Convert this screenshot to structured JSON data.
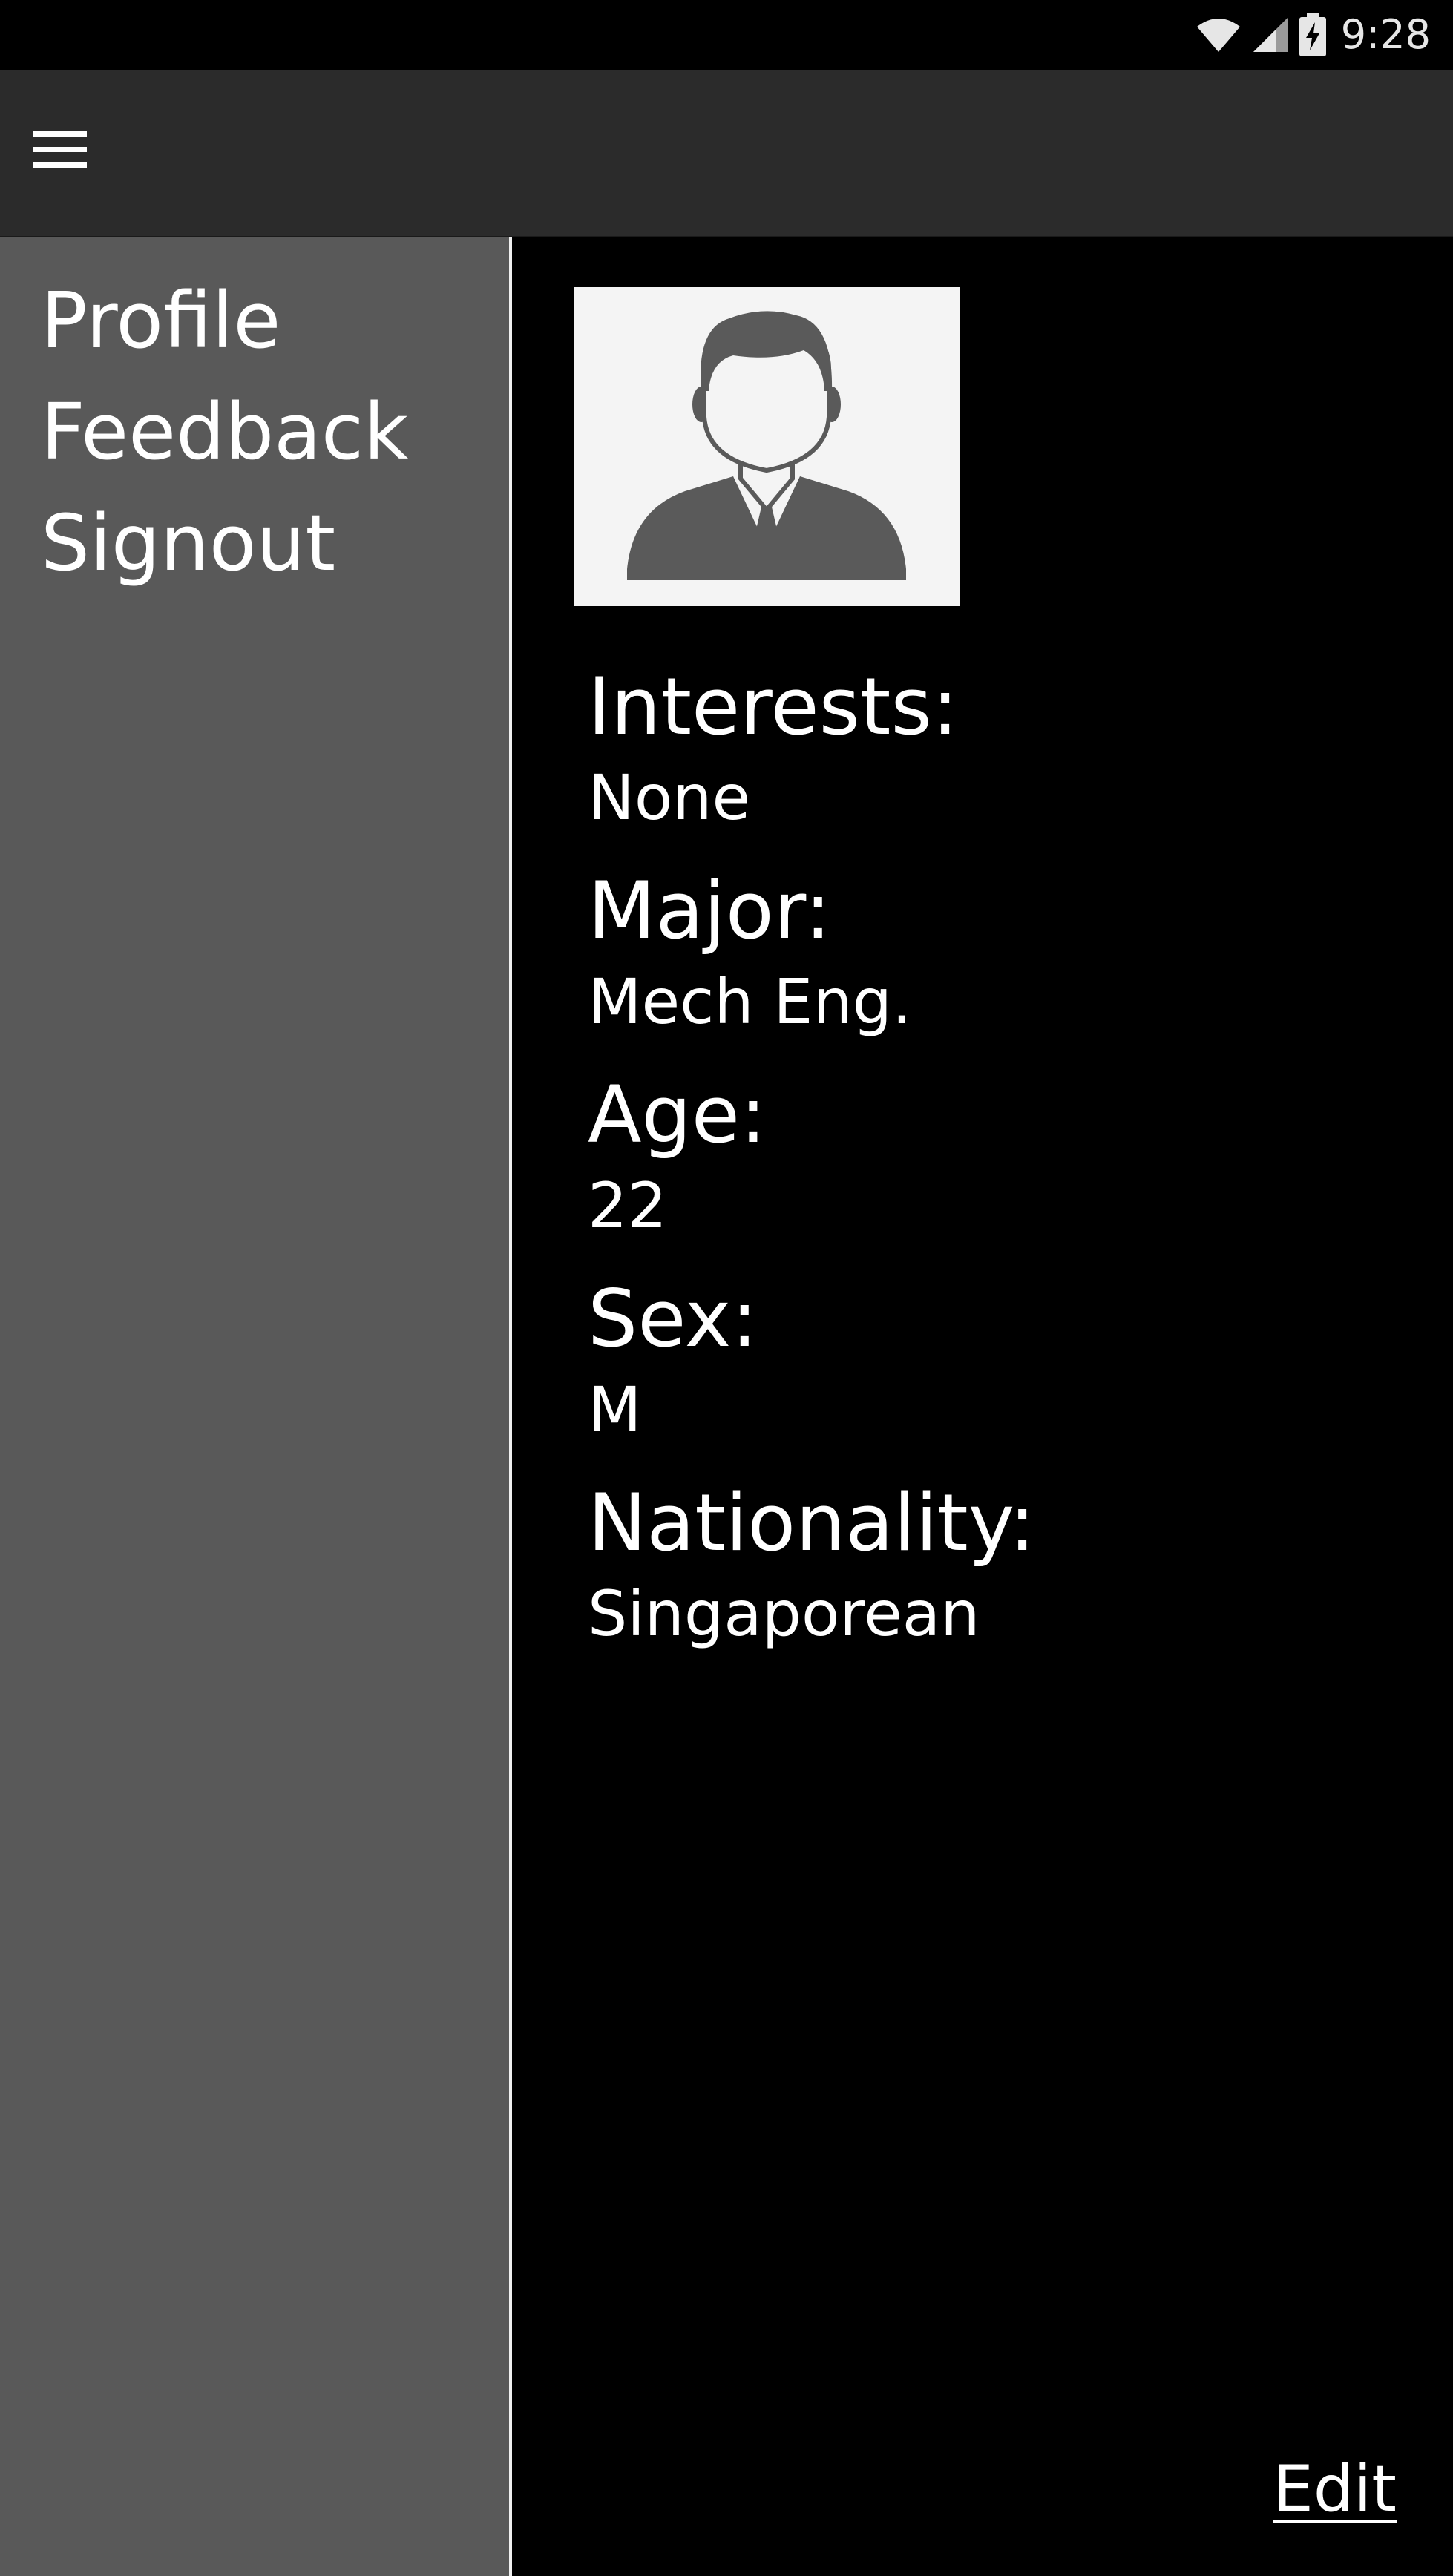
{
  "status_bar": {
    "time": "9:28",
    "icons": [
      "wifi-icon",
      "cellular-signal-icon",
      "battery-charging-icon"
    ]
  },
  "app_bar": {
    "menu_icon": "hamburger-menu-icon"
  },
  "drawer": {
    "items": [
      {
        "label": "Profile"
      },
      {
        "label": "Feedback"
      },
      {
        "label": "Signout"
      }
    ]
  },
  "profile": {
    "avatar_icon": "user-avatar-icon",
    "fields": [
      {
        "label": "Interests:",
        "value": "None"
      },
      {
        "label": "Major:",
        "value": "Mech Eng."
      },
      {
        "label": "Age:",
        "value": "22"
      },
      {
        "label": "Sex:",
        "value": "M"
      },
      {
        "label": "Nationality:",
        "value": "Singaporean"
      }
    ],
    "edit_label": "Edit"
  },
  "colors": {
    "status_bar": "#000000",
    "app_bar": "#2b2b2b",
    "drawer": "#595959",
    "content": "#000000",
    "avatar_bg": "#f4f4f4",
    "avatar_figure": "#5a5a5a",
    "text": "#ffffff"
  }
}
